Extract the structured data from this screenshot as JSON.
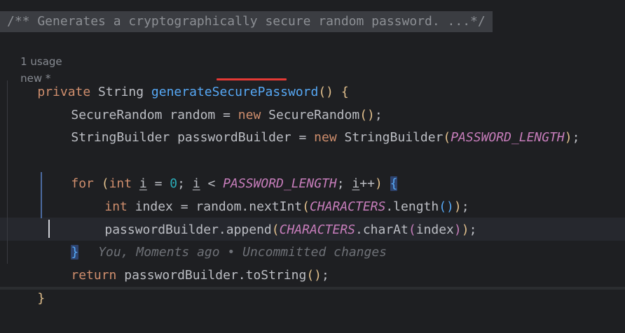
{
  "doc_comment": "/** Generates a cryptographically secure random password. ...*/",
  "hints": {
    "usage": "1 usage",
    "author": "new *"
  },
  "code": {
    "l1": {
      "kw": "private",
      "type": " String ",
      "fn": "generateSecurePassword",
      "open": "()",
      "brace": " {"
    },
    "l2": {
      "a": "SecureRandom random = ",
      "kw": "new",
      "b": " SecureRandom",
      "p": "()",
      "end": ";"
    },
    "l3": {
      "a": "StringBuilder passwordBuilder = ",
      "kw": "new",
      "b": " StringBuilder",
      "p1": "(",
      "const": "PASSWORD_LENGTH",
      "p2": ")",
      "end": ";"
    },
    "l5": {
      "kw_for": "for",
      "sp1": " ",
      "po": "(",
      "kw_int": "int",
      "sp2": " ",
      "i1": "i",
      "eq": " = ",
      "zero": "0",
      "semi1": "; ",
      "i2": "i",
      "lt": " < ",
      "const": "PASSWORD_LENGTH",
      "semi2": "; ",
      "i3": "i",
      "inc": "++",
      "pc": ")",
      "sp3": " ",
      "brace": "{"
    },
    "l6": {
      "kw_int": "int",
      "a": " index = random.nextInt",
      "p1": "(",
      "const": "CHARACTERS",
      "b": ".length",
      "p2": "()",
      "p3": ")",
      "end": ";"
    },
    "l7": {
      "a": "passwordBuilder.append",
      "p1": "(",
      "const": "CHARACTERS",
      "b": ".charAt",
      "p2": "(",
      "c": "index",
      "p3": ")",
      "p4": ")",
      "end": ";"
    },
    "l8": {
      "brace": "}",
      "blame": "You, Moments ago • Uncommitted changes"
    },
    "l9": {
      "kw": "return",
      "a": " passwordBuilder.toString",
      "p": "()",
      "end": ";"
    },
    "l10": {
      "brace": "}"
    }
  }
}
